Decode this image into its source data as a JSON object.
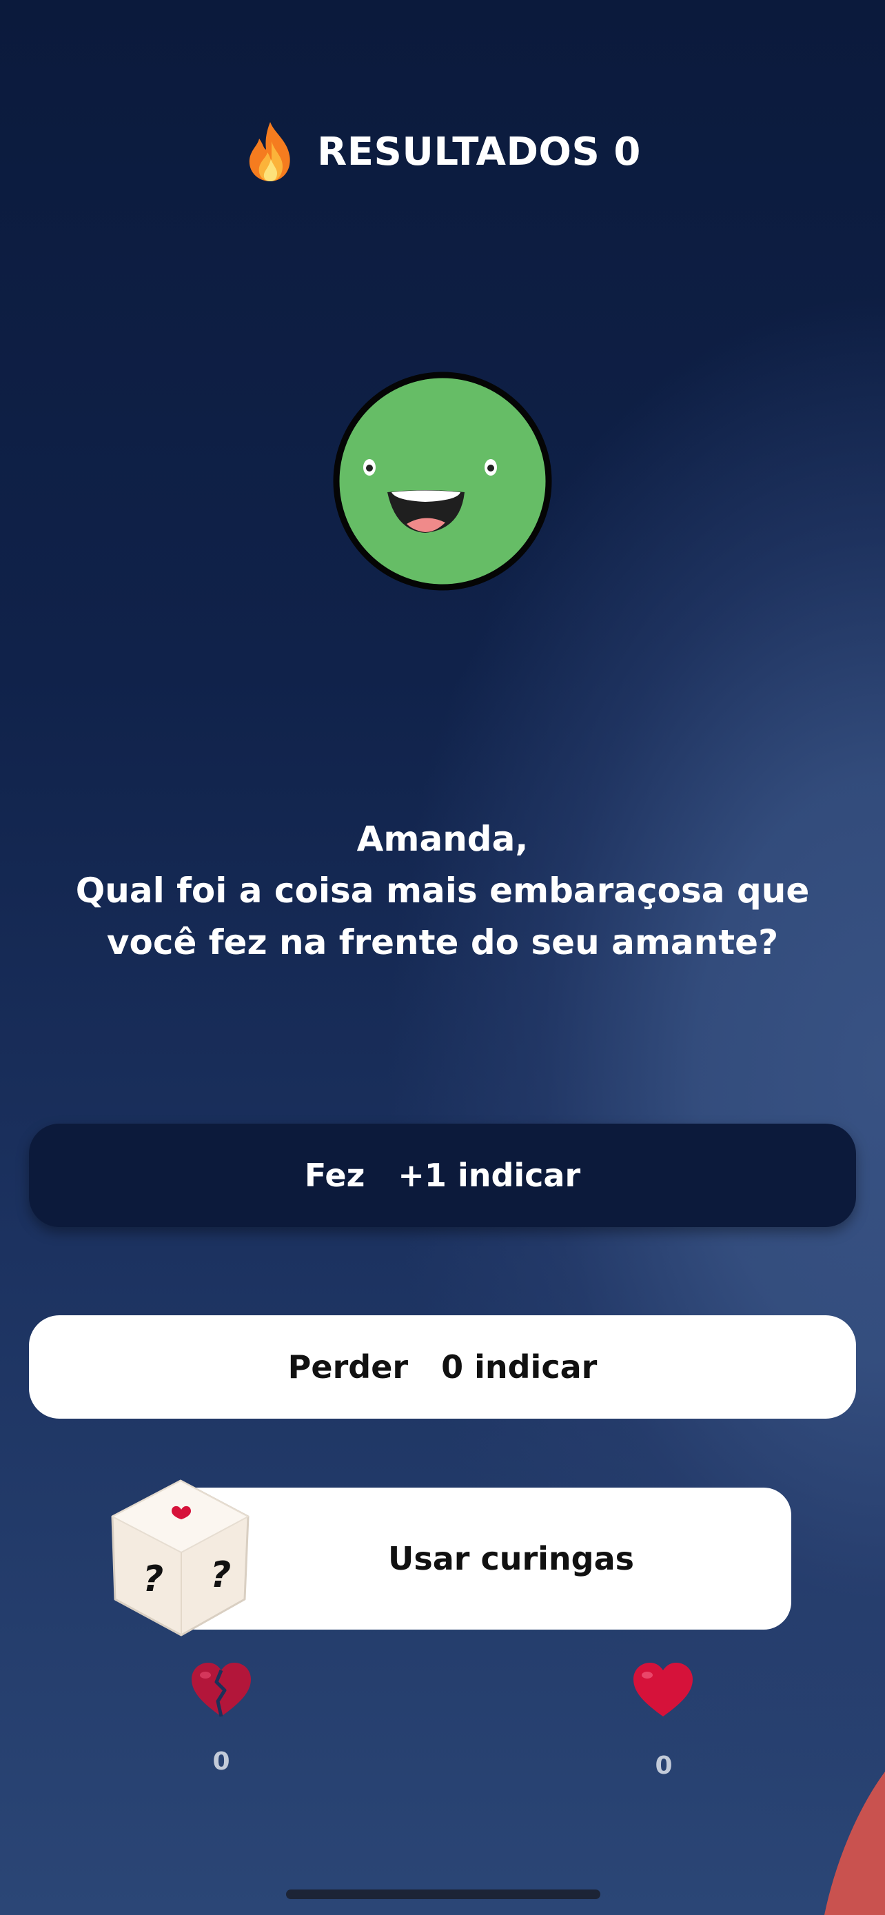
{
  "header": {
    "title": "RESULTADOS 0",
    "icon": "fire-icon"
  },
  "avatar": {
    "icon": "smiling-face-icon",
    "color": "#66bd66"
  },
  "question": {
    "name_line": "Amanda,",
    "line1": "Qual foi a coisa mais embaraçosa que",
    "line2": "você fez na frente do seu amante?"
  },
  "buttons": {
    "did": {
      "label": "Fez",
      "points": "+1 indicar"
    },
    "lose": {
      "label": "Perder",
      "points": "0 indicar"
    },
    "wildcard": {
      "label": "Usar curingas",
      "icon": "dice-icon"
    }
  },
  "hearts": {
    "broken": {
      "icon": "broken-heart-icon",
      "count": "0"
    },
    "full": {
      "icon": "heart-icon",
      "count": "0"
    }
  },
  "colors": {
    "accent_red": "#d6123a",
    "dark_button": "#0c1a3b",
    "light_button": "#ffffff"
  }
}
